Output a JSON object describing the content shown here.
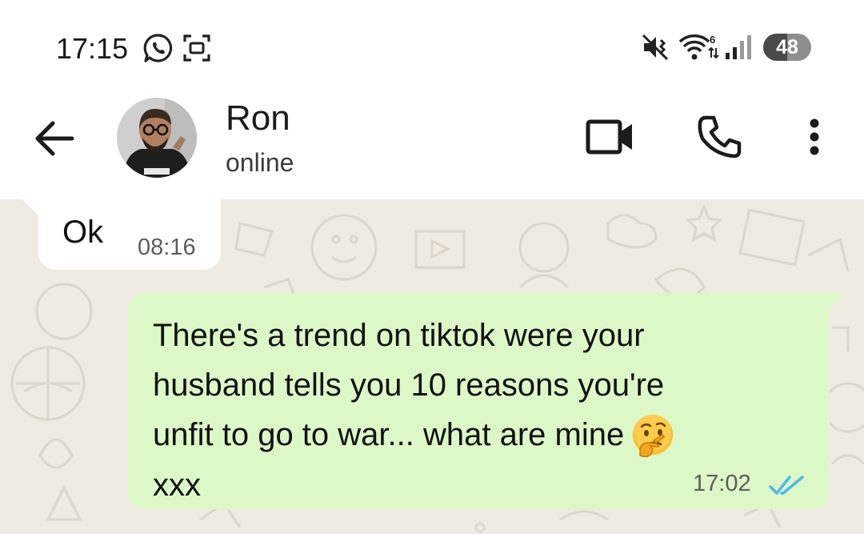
{
  "status_bar": {
    "time": "17:15",
    "battery": "48",
    "icons": [
      "whatsapp-icon",
      "screen-record-icon",
      "vibrate-icon",
      "wifi-6-icon",
      "signal-icon",
      "battery-icon"
    ]
  },
  "header": {
    "contact_name": "Ron",
    "contact_status": "online",
    "icons": [
      "back-arrow-icon",
      "video-call-icon",
      "voice-call-icon",
      "more-options-icon"
    ]
  },
  "messages": [
    {
      "direction": "incoming",
      "text": "Ok",
      "time": "08:16"
    },
    {
      "direction": "outgoing",
      "lines": [
        "There's a trend on tiktok were your",
        "husband tells you 10 reasons you're",
        "unfit to go to war... what are mine",
        "xxx"
      ],
      "emoji": "thinking-face-emoji",
      "time": "17:02",
      "status": "read"
    }
  ],
  "colors": {
    "chat_background": "#efeae2",
    "outgoing_bubble": "#dcf8c6",
    "incoming_bubble": "#ffffff",
    "read_ticks": "#4fb6ec"
  }
}
